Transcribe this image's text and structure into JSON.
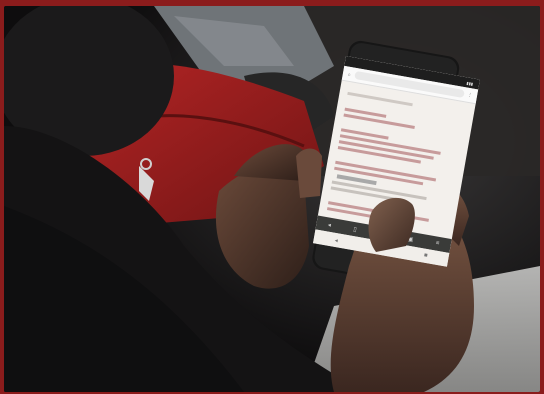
{
  "scene": {
    "description_colors": {
      "border": "#8b1c1c",
      "backpack": "#a31f1f",
      "screen_bg": "#f3f0ec",
      "accent_text": "#9a3b3b"
    }
  },
  "phone": {
    "status_bar": {
      "time": "",
      "icons": "signal-wifi-battery-icons"
    },
    "browser": {
      "url": "",
      "url_icon": "home-icon",
      "menu_icon": "more-vert-icon"
    },
    "content": {
      "lines": []
    },
    "bottom_toolbar": {
      "icons": [
        "back-icon",
        "bookmark-icon",
        "share-icon",
        "tabs-icon",
        "menu-icon"
      ]
    }
  }
}
